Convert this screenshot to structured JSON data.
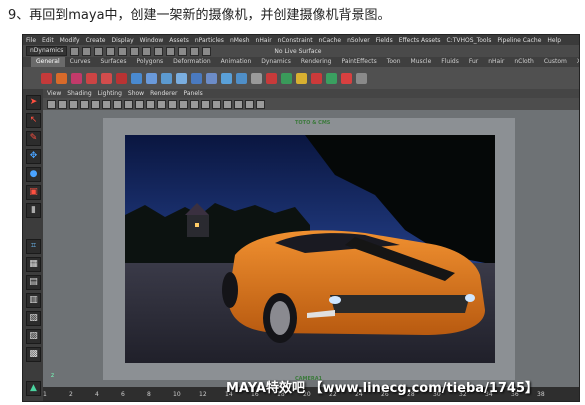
{
  "caption": "9、再回到maya中，创建一架新的摄像机，并创建摄像机背景图。",
  "menu": [
    "File",
    "Edit",
    "Modify",
    "Create",
    "Display",
    "Window",
    "Assets",
    "nParticles",
    "nMesh",
    "nHair",
    "nConstraint",
    "nCache",
    "nSolver",
    "Fields",
    "Effects Assets",
    "C:TVHOS_Tools",
    "Pipeline Cache",
    "Help"
  ],
  "status": {
    "mode": "nDynamics",
    "live_surface": "No Live Surface"
  },
  "shelf_tabs": [
    "General",
    "Curves",
    "Surfaces",
    "Polygons",
    "Deformation",
    "Animation",
    "Dynamics",
    "Rendering",
    "PaintEffects",
    "Toon",
    "Muscle",
    "Fluids",
    "Fur",
    "nHair",
    "nCloth",
    "Custom",
    "XGen",
    "mr"
  ],
  "active_shelf_tab": "General",
  "panel_menu": [
    "View",
    "Shading",
    "Lighting",
    "Show",
    "Renderer",
    "Panels"
  ],
  "viewport": {
    "camera_label_top": "TOTO & CMS",
    "camera_label_bottom": "CAMERA1",
    "axis": "z"
  },
  "timeline": [
    "1",
    "2",
    "4",
    "6",
    "8",
    "10",
    "12",
    "14",
    "16",
    "18",
    "20",
    "22",
    "24",
    "26",
    "28",
    "30",
    "32",
    "34",
    "36",
    "38"
  ],
  "watermark": "MAYA特效吧 【www.linecg.com/tieba/1745】"
}
